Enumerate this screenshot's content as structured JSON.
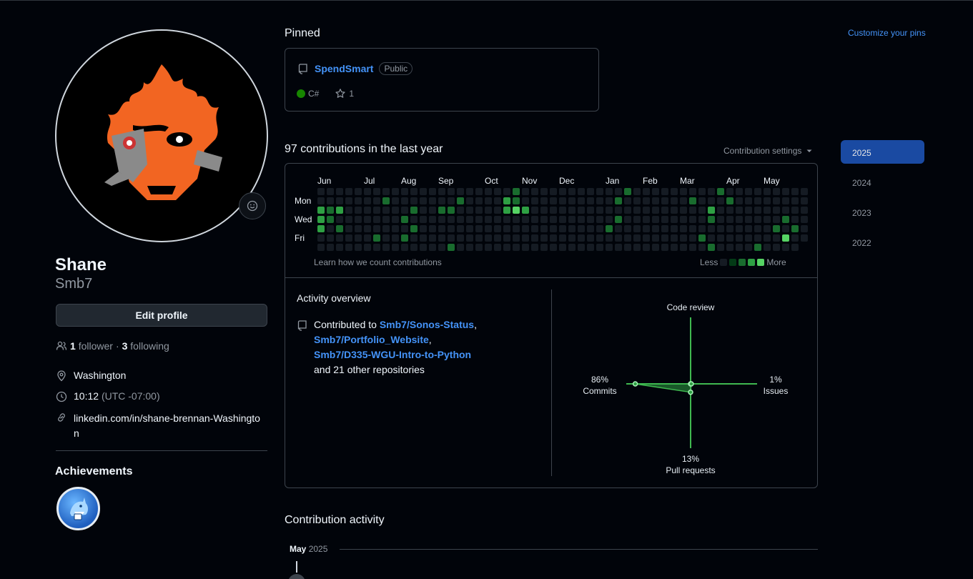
{
  "profile": {
    "name": "Shane",
    "login": "Smb7",
    "edit_label": "Edit profile",
    "followers_count": "1",
    "followers_label": "follower",
    "separator": "·",
    "following_count": "3",
    "following_label": "following",
    "location": "Washington",
    "time": "10:12",
    "timezone": "(UTC -07:00)",
    "link": "linkedin.com/in/shane-brennan-Washington"
  },
  "achievements": {
    "title": "Achievements"
  },
  "pinned": {
    "title": "Pinned",
    "customize": "Customize your pins",
    "repo_name": "SpendSmart",
    "visibility": "Public",
    "language": "C#",
    "language_color": "#178600",
    "stars": "1"
  },
  "contributions": {
    "title": "97 contributions in the last year",
    "settings_label": "Contribution settings",
    "months": [
      "Jun",
      "Jul",
      "Aug",
      "Sep",
      "Oct",
      "Nov",
      "Dec",
      "Jan",
      "Feb",
      "Mar",
      "Apr",
      "May"
    ],
    "days": [
      "Mon",
      "Wed",
      "Fri"
    ],
    "learn": "Learn how we count contributions",
    "less": "Less",
    "more": "More",
    "level_colors": [
      "#151b23",
      "#033a16",
      "#196c2e",
      "#2ea043",
      "#56d364"
    ]
  },
  "overview": {
    "title": "Activity overview",
    "contributed_to": "Contributed to",
    "repo1": "Smb7/Sonos-Status",
    "comma": ",",
    "repo2": "Smb7/Portfolio_Website",
    "repo3": "Smb7/D335-WGU-Intro-to-Python",
    "others": "and 21 other repositories",
    "code_review": "Code review",
    "commits_pct": "86%",
    "commits_label": "Commits",
    "issues_pct": "1%",
    "issues_label": "Issues",
    "prs_pct": "13%",
    "prs_label": "Pull requests"
  },
  "chart_data": {
    "type": "radar",
    "axes": [
      "Code review",
      "Issues",
      "Pull requests",
      "Commits"
    ],
    "values": [
      0,
      1,
      13,
      86
    ]
  },
  "years": [
    "2025",
    "2024",
    "2023",
    "2022"
  ],
  "activity": {
    "title": "Contribution activity",
    "month": "May",
    "year": "2025"
  }
}
